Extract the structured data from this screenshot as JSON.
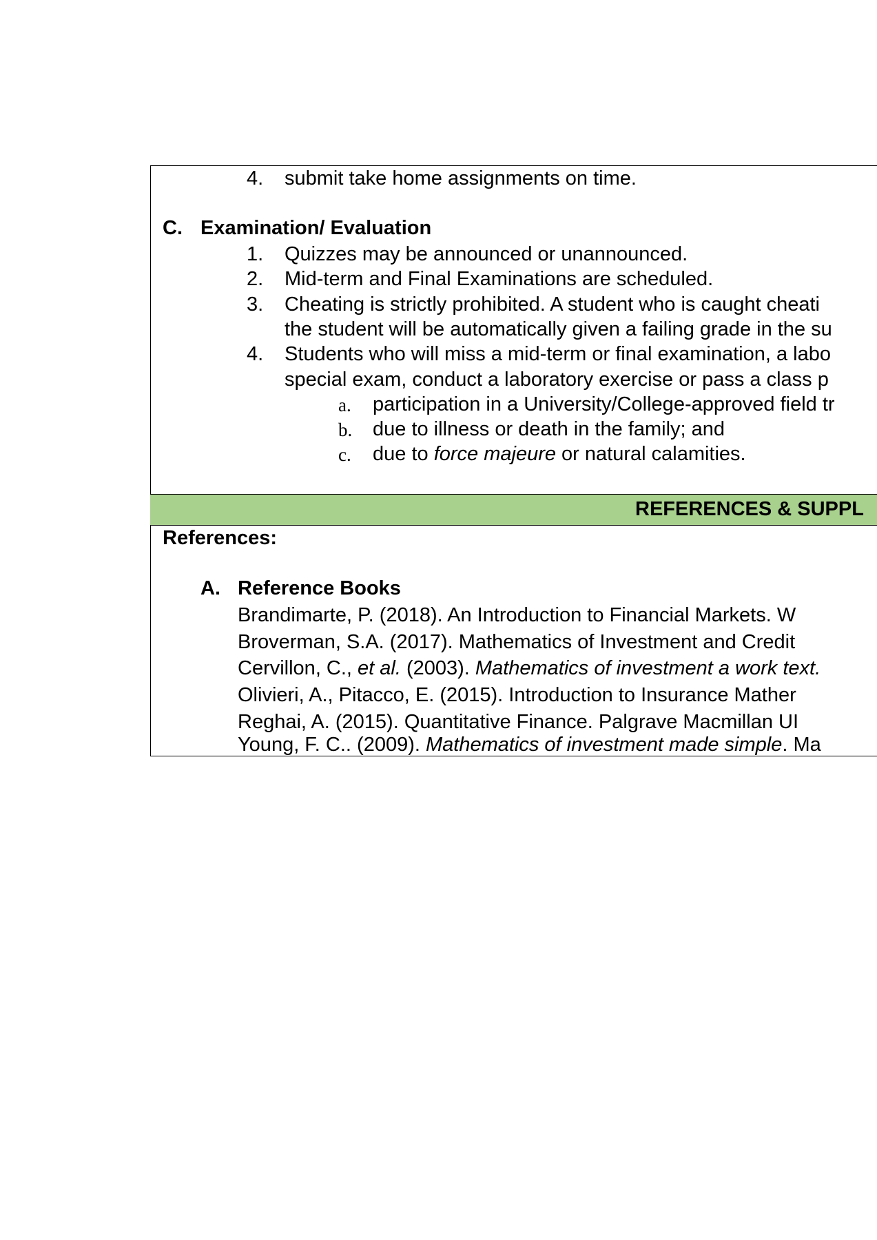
{
  "section_b": {
    "item4_num": "4.",
    "item4_text": "submit take home assignments on time."
  },
  "section_c": {
    "letter": "C.",
    "heading": "Examination/ Evaluation",
    "items": [
      {
        "num": "1.",
        "text": "Quizzes may be announced or unannounced."
      },
      {
        "num": "2.",
        "text": "Mid-term and Final Examinations are scheduled."
      },
      {
        "num": "3.",
        "text": "Cheating is strictly prohibited. A student who is caught cheati",
        "text2": "the student will be automatically given a failing grade in the su"
      },
      {
        "num": "4.",
        "text": "Students who will miss a mid-term or final examination, a labo",
        "text2": "special exam, conduct a laboratory exercise or pass a class p"
      }
    ],
    "subitems": [
      {
        "letter": "a.",
        "text": "participation in a University/College-approved field tr"
      },
      {
        "letter": "b.",
        "text": "due to illness or death in the family; and"
      },
      {
        "letter": "c.",
        "pre": "due to ",
        "italic": "force majeure",
        "post": " or natural calamities."
      }
    ]
  },
  "band": {
    "title": "REFERENCES & SUPPL"
  },
  "references": {
    "label": "References:",
    "section_letter": "A.",
    "section_title": "Reference Books",
    "entries": [
      {
        "text": "Brandimarte, P. (2018). An Introduction to Financial Markets. W"
      },
      {
        "text": "Broverman, S.A. (2017). Mathematics of Investment and Credit"
      },
      {
        "pre": "Cervillon, C., ",
        "italic1": "et al.",
        "mid": " (2003). ",
        "italic2": "Mathematics of investment a work text."
      },
      {
        "text": "Olivieri, A., Pitacco, E. (2015). Introduction to Insurance Mather"
      },
      {
        "text": "Reghai, A. (2015). Quantitative Finance. Palgrave Macmillan UI"
      },
      {
        "pre": "Young, F. C.. (2009). ",
        "italic": "Mathematics of investment made simple",
        "post": ". Ma"
      }
    ]
  }
}
